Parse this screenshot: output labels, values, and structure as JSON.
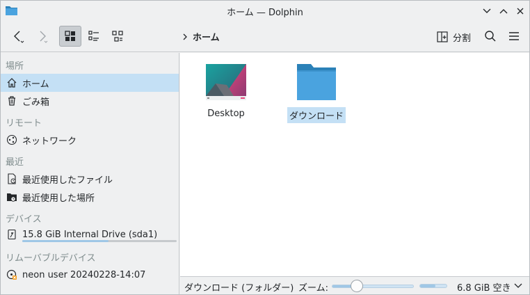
{
  "window": {
    "title": "ホーム — Dolphin",
    "buttons": [
      "minimize",
      "maximize",
      "close"
    ]
  },
  "toolbar": {
    "back_icon": "chevron-left-icon",
    "forward_icon": "chevron-right-icon",
    "view_modes": [
      "icons-view",
      "compact-view",
      "details-view"
    ],
    "active_view": "icons-view",
    "breadcrumb": [
      "ホーム"
    ],
    "split_label": "分割",
    "search_icon": "search-icon",
    "menu_icon": "hamburger-menu-icon"
  },
  "sidebar": {
    "sections": [
      {
        "heading": "場所",
        "items": [
          {
            "label": "ホーム",
            "icon": "home-icon",
            "selected": true
          },
          {
            "label": "ごみ箱",
            "icon": "trash-icon",
            "selected": false
          }
        ]
      },
      {
        "heading": "リモート",
        "items": [
          {
            "label": "ネットワーク",
            "icon": "network-icon",
            "selected": false
          }
        ]
      },
      {
        "heading": "最近",
        "items": [
          {
            "label": "最近使用したファイル",
            "icon": "recent-files-icon",
            "selected": false
          },
          {
            "label": "最近使用した場所",
            "icon": "recent-locations-icon",
            "selected": false
          }
        ]
      },
      {
        "heading": "デバイス",
        "items": [
          {
            "label": "15.8 GiB Internal Drive (sda1)",
            "icon": "drive-icon",
            "selected": false,
            "used_fraction": 0.56
          }
        ]
      },
      {
        "heading": "リムーバブルデバイス",
        "items": [
          {
            "label": "neon user 20240228-14:07",
            "icon": "optical-disc-icon",
            "selected": false
          }
        ]
      }
    ]
  },
  "files": [
    {
      "name": "Desktop",
      "type": "folder-desktop",
      "selected": false
    },
    {
      "name": "ダウンロード",
      "type": "folder",
      "selected": true
    }
  ],
  "statusbar": {
    "selection_text": "ダウンロード (フォルダー)",
    "zoom_label": "ズーム:",
    "zoom_fraction": 0.3,
    "free_space_text": "6.8 GiB 空き",
    "free_space_fraction": 0.57
  },
  "colors": {
    "selection": "#c4e0f5",
    "folder_blue": "#4aa3df",
    "folder_tab": "#2b81b8",
    "text": "#232629",
    "muted": "#7f8c8d"
  }
}
